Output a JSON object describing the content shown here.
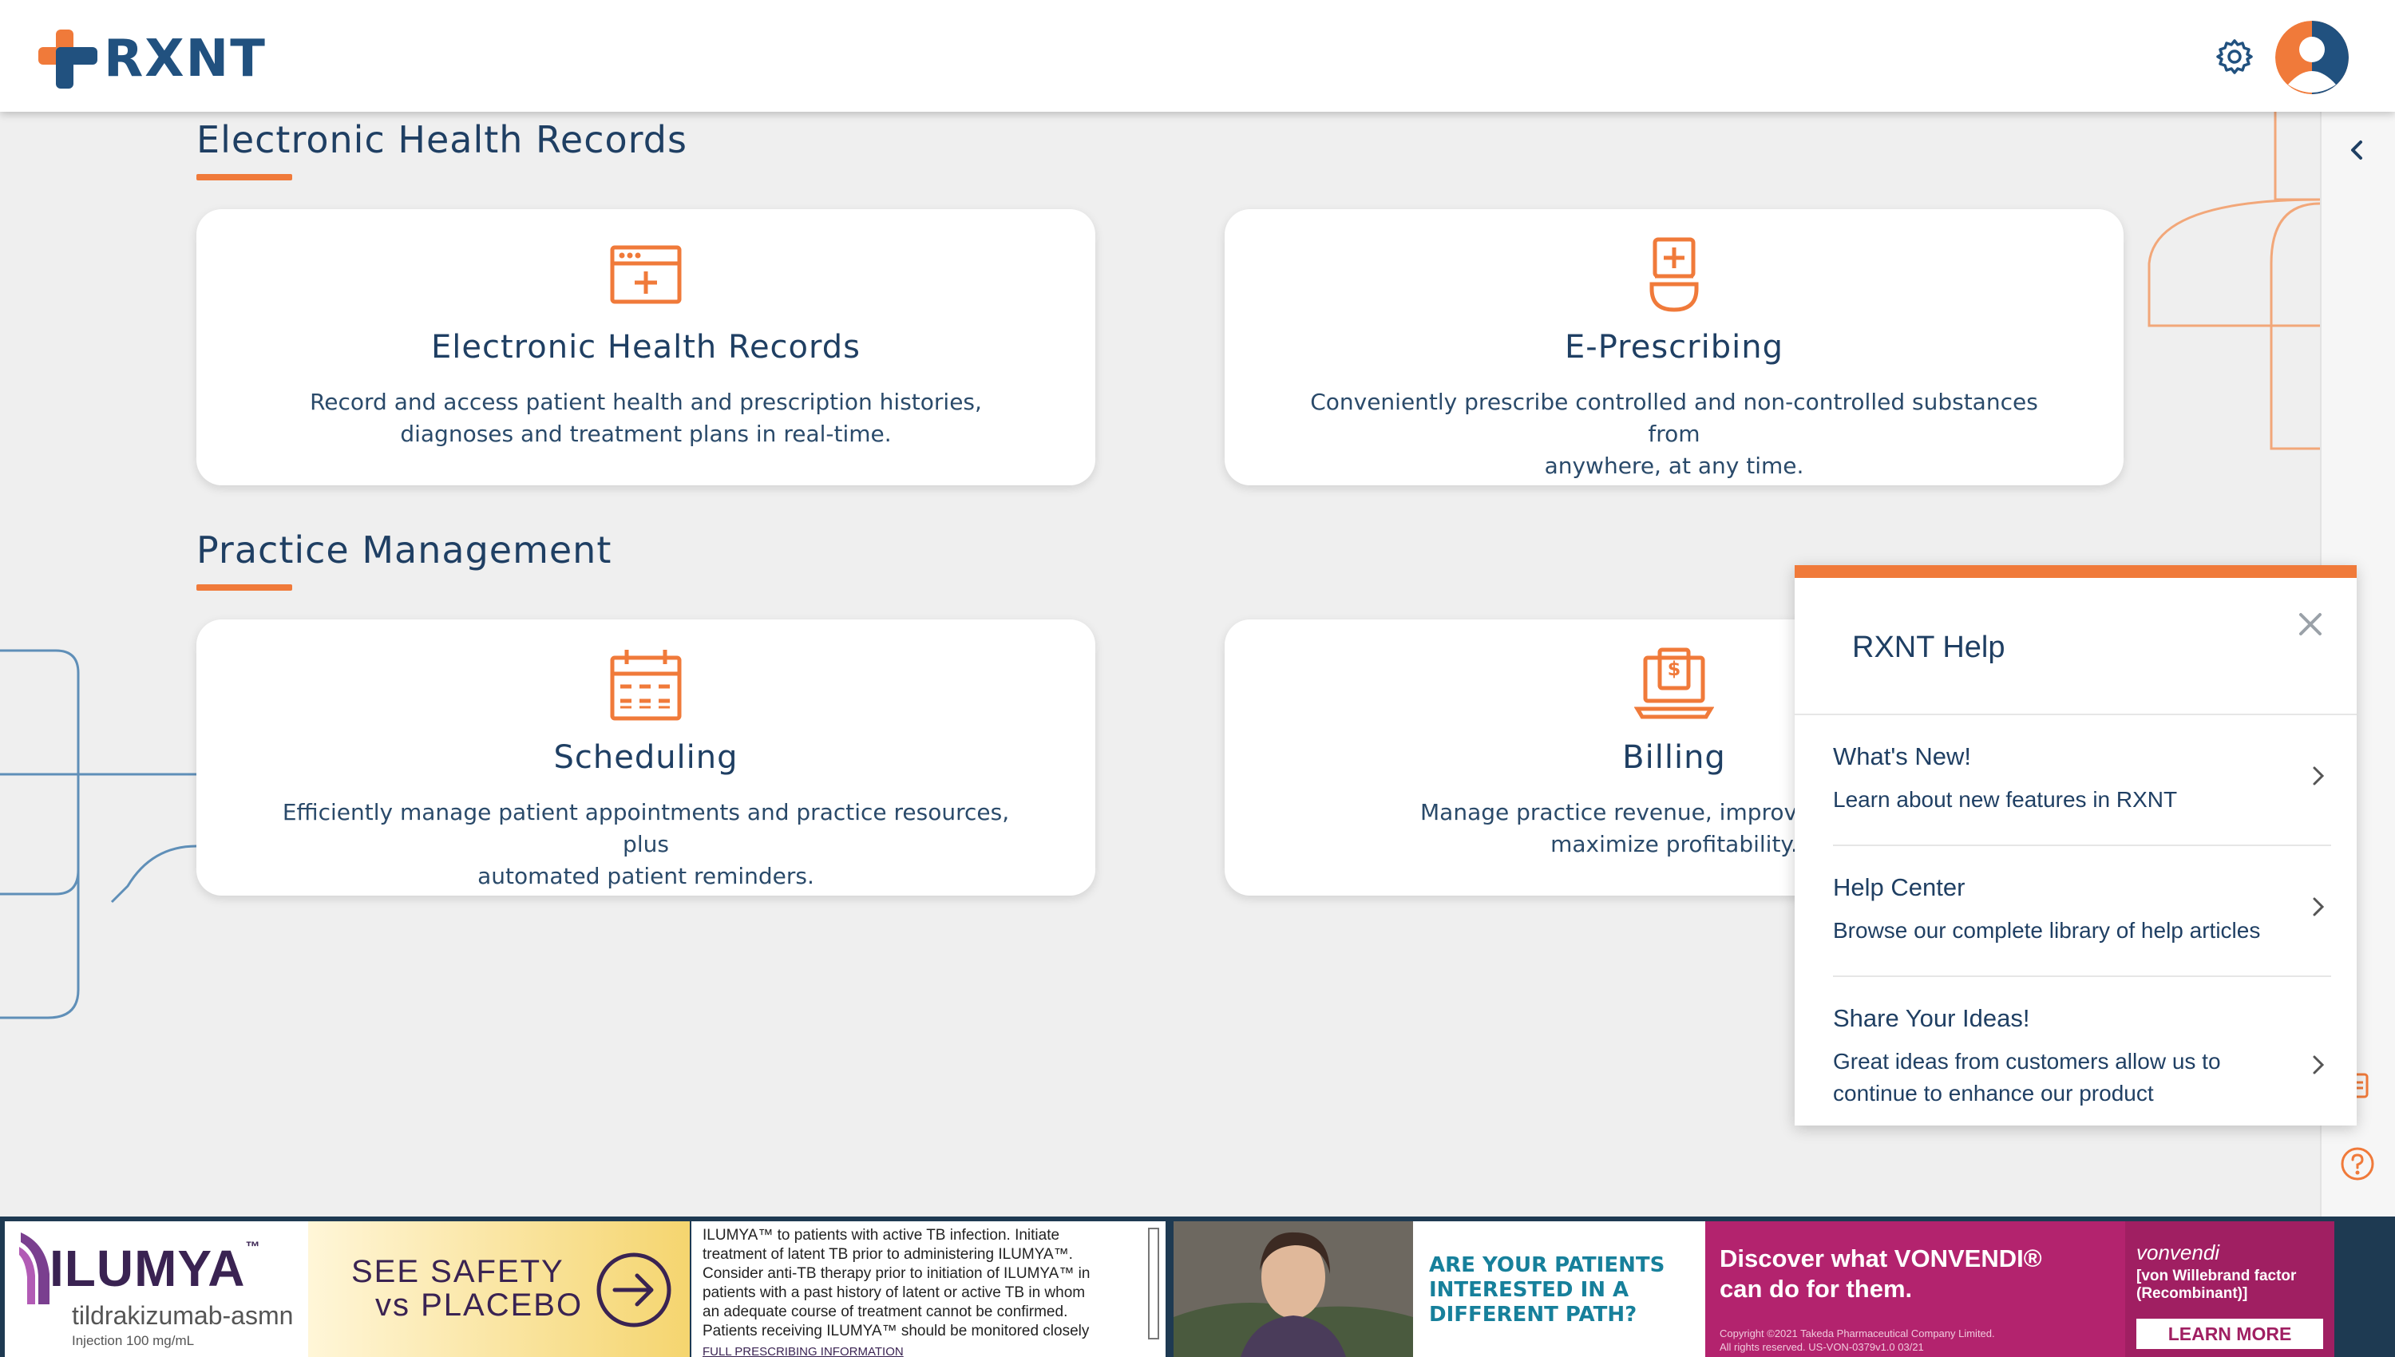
{
  "app": {
    "logo_text": "RXNT"
  },
  "colors": {
    "brand_orange": "#f07a3a",
    "brand_navy": "#21517f",
    "background": "#efefef"
  },
  "header": {
    "settings_icon": "gear-icon",
    "avatar_icon": "user-avatar-icon"
  },
  "sections": [
    {
      "title": "Electronic Health Records",
      "cards": [
        {
          "icon": "health-record-window-icon",
          "title": "Electronic Health Records",
          "desc_line1": "Record and access patient health and prescription histories,",
          "desc_line2": "diagnoses and treatment plans in real-time."
        },
        {
          "icon": "prescription-icon",
          "title": "E-Prescribing",
          "desc_line1": "Conveniently prescribe controlled and non-controlled substances from",
          "desc_line2": "anywhere, at any time."
        }
      ]
    },
    {
      "title": "Practice Management",
      "cards": [
        {
          "icon": "calendar-icon",
          "title": "Scheduling",
          "desc_line1": "Efficiently manage patient appointments and practice resources, plus",
          "desc_line2": "automated patient reminders."
        },
        {
          "icon": "billing-laptop-icon",
          "title": "Billing",
          "desc_line1": "Manage practice revenue, improve the rate o",
          "desc_line2": "maximize profitability."
        }
      ]
    }
  ],
  "help_panel": {
    "title": "RXNT Help",
    "items": [
      {
        "title": "What's New!",
        "desc": "Learn about new features in RXNT"
      },
      {
        "title": "Help Center",
        "desc": "Browse our complete library of help articles"
      },
      {
        "title": "Share Your Ideas!",
        "desc": "Great ideas from customers allow us to continue to enhance our product"
      }
    ]
  },
  "ads": {
    "ilumya": {
      "brand": "ILUMYA",
      "trademark": "™",
      "generic": "tildrakizumab-asmn",
      "dosage": "Injection 100 mg/mL",
      "cta_line1": "SEE SAFETY",
      "cta_line2": "vs PLACEBO",
      "isi_lines": [
        "ILUMYA™ to patients with active TB infection. Initiate",
        "treatment of latent TB prior to administering ILUMYA™.",
        "Consider anti-TB therapy prior to initiation of ILUMYA™ in",
        "patients with a past history of latent or active TB in whom",
        "an adequate course of treatment cannot be confirmed.",
        "Patients receiving ILUMYA™ should be monitored closely"
      ],
      "link": "FULL PRESCRIBING INFORMATION"
    },
    "path": {
      "line1": "ARE YOUR PATIENTS",
      "line2": "INTERESTED IN A",
      "line3": "DIFFERENT PATH?"
    },
    "vonvendi": {
      "headline_line1": "Discover what VONVENDI®",
      "headline_line2": "can do for them.",
      "copyright_line1": "Copyright ©2021 Takeda Pharmaceutical Company Limited.",
      "copyright_line2": "All rights reserved.  US-VON-0379v1.0 03/21",
      "brand": "vonvendi",
      "brand_sub_line1": "[von Willebrand factor",
      "brand_sub_line2": "(Recombinant)]",
      "cta": "LEARN MORE"
    }
  }
}
